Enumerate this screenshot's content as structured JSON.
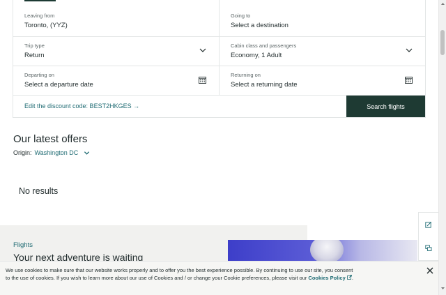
{
  "search": {
    "leaving_label": "Leaving from",
    "leaving_value": "Toronto, (YYZ)",
    "going_label": "Going to",
    "going_value": "Select a destination",
    "trip_label": "Trip type",
    "trip_value": "Return",
    "cabin_label": "Cabin class and passengers",
    "cabin_value": "Economy, 1 Adult",
    "depart_label": "Departing on",
    "depart_value": "Select a departure date",
    "return_label": "Returning on",
    "return_value": "Select a returning date",
    "discount_text": "Edit the discount code: BEST2HKGES →",
    "search_button": "Search flights"
  },
  "offers": {
    "title": "Our latest offers",
    "origin_label": "Origin:",
    "origin_value": "Washington DC",
    "no_results": "No results"
  },
  "promo": {
    "eyebrow": "Flights",
    "title": "Your next adventure is waiting"
  },
  "cookie": {
    "text": "We use cookies to make sure that our website works properly and to offer you the best experience possible. By continuing to use our site, you consent to the use of cookies. If you wish to learn more about our use of Cookies and / or change your Cookie preferences, please visit our",
    "link": "Cookies Policy"
  },
  "colors": {
    "accent": "#1f6b73",
    "button": "#1e3a33"
  }
}
